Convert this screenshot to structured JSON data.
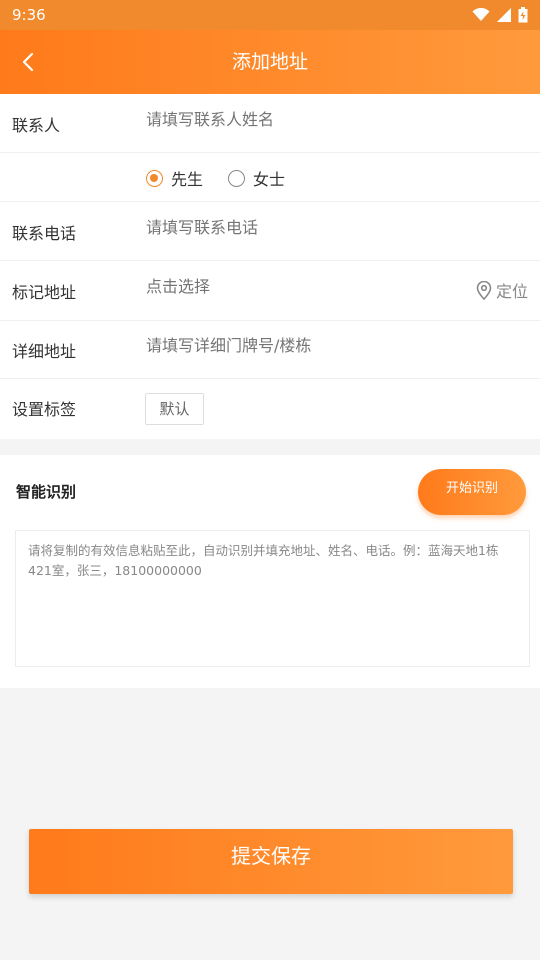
{
  "status_bar": {
    "time": "9:36"
  },
  "app_bar": {
    "title": "添加地址"
  },
  "form": {
    "contact": {
      "label": "联系人",
      "placeholder": "请填写联系人姓名"
    },
    "gender": {
      "options": [
        "先生",
        "女士"
      ],
      "selected": "先生"
    },
    "phone": {
      "label": "联系电话",
      "placeholder": "请填写联系电话"
    },
    "mark_address": {
      "label": "标记地址",
      "placeholder": "点击选择",
      "locate_label": "定位"
    },
    "detail_address": {
      "label": "详细地址",
      "placeholder": "请填写详细门牌号/楼栋"
    },
    "tag": {
      "label": "设置标签",
      "chip": "默认"
    }
  },
  "smart": {
    "title": "智能识别",
    "button": "开始识别",
    "placeholder": "请将复制的有效信息粘贴至此，自动识别并填充地址、姓名、电话。例：蓝海天地1栋421室，张三，18100000000"
  },
  "submit": {
    "label": "提交保存"
  },
  "colors": {
    "accent": "#ff7a1a",
    "accent_light": "#ff9a3c"
  }
}
